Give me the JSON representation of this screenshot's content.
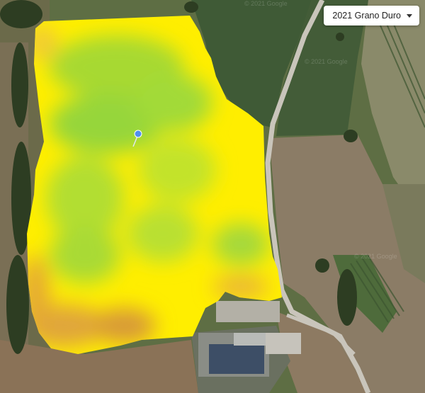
{
  "season_selector": {
    "label": "2021 Grano Duro",
    "icon": "chevron-down-icon"
  },
  "map": {
    "background": "satellite-imagery",
    "overlay": "crop-vigor-index",
    "marker_icon": "location-pin-icon",
    "watermark": "© 2021 Google"
  },
  "colors": {
    "low": "#d98a2b",
    "mid": "#ffee00",
    "high": "#9fdc34"
  }
}
